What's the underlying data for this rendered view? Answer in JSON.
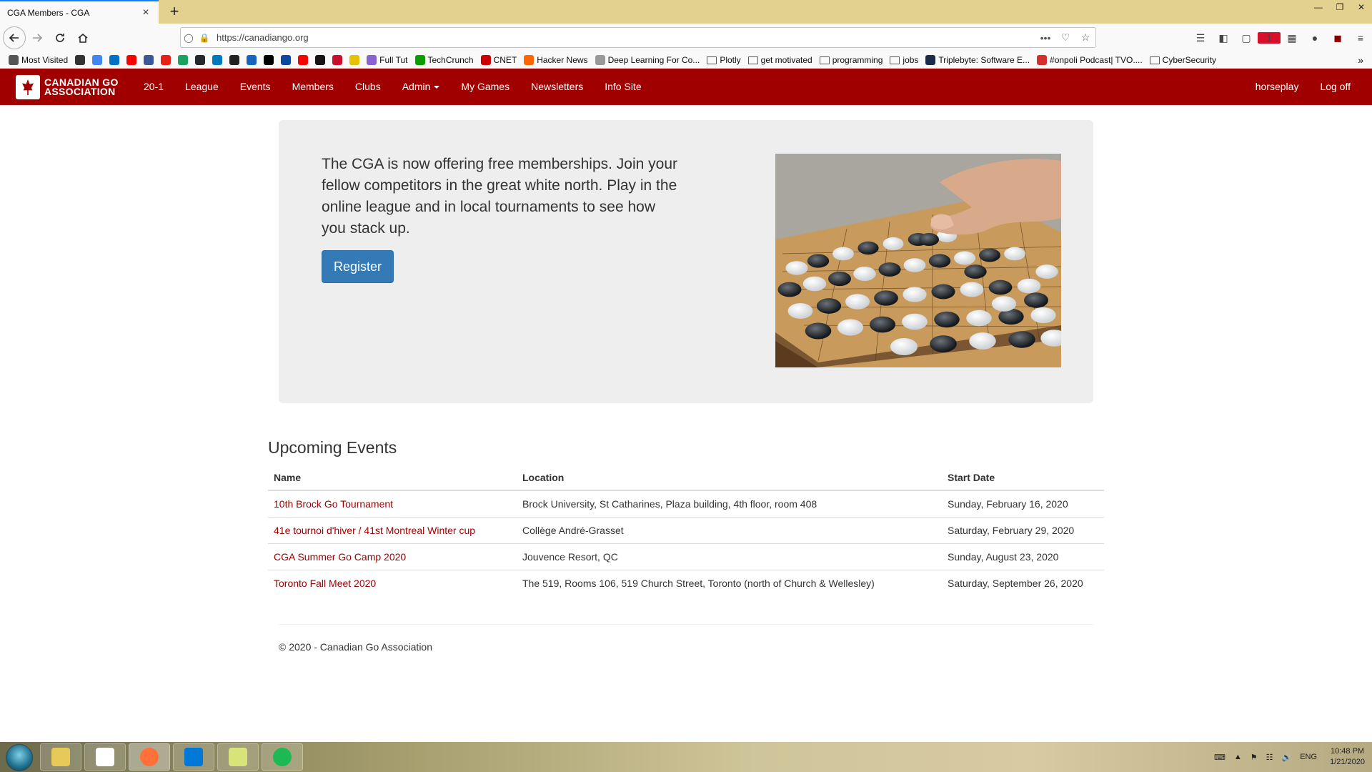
{
  "browser": {
    "tab_title": "CGA Members - CGA",
    "tab_close": "×",
    "new_tab": "+",
    "url": "https://canadiango.org",
    "url_dots": "•••",
    "bookmarks": [
      {
        "label": "Most Visited",
        "color": "#555555",
        "icon": "gear"
      },
      {
        "label": "",
        "color": "#333333",
        "icon": "globe"
      },
      {
        "label": "",
        "color": "#4285f4",
        "icon": "google"
      },
      {
        "label": "",
        "color": "#0072c6",
        "icon": "outlook"
      },
      {
        "label": "",
        "color": "#ff0000",
        "icon": "youtube"
      },
      {
        "label": "",
        "color": "#3b5998",
        "icon": "facebook"
      },
      {
        "label": "",
        "color": "#e62117",
        "icon": "app"
      },
      {
        "label": "",
        "color": "#1aa260",
        "icon": "app"
      },
      {
        "label": "",
        "color": "#24292e",
        "icon": "github"
      },
      {
        "label": "",
        "color": "#0079bf",
        "icon": "trello"
      },
      {
        "label": "",
        "color": "#222222",
        "icon": "app"
      },
      {
        "label": "",
        "color": "#1565c0",
        "icon": "app"
      },
      {
        "label": "",
        "color": "#000000",
        "icon": "app"
      },
      {
        "label": "",
        "color": "#0d47a1",
        "icon": "app"
      },
      {
        "label": "",
        "color": "#ff0000",
        "icon": "youtube"
      },
      {
        "label": "",
        "color": "#191414",
        "icon": "spotify"
      },
      {
        "label": "",
        "color": "#c8102e",
        "icon": "app"
      },
      {
        "label": "",
        "color": "#e6c200",
        "icon": "app"
      },
      {
        "label": "Full Tut",
        "color": "#8a63d2",
        "icon": "app"
      },
      {
        "label": "TechCrunch",
        "color": "#0a9e01",
        "icon": "app"
      },
      {
        "label": "CNET",
        "color": "#cc0000",
        "icon": "app"
      },
      {
        "label": "Hacker News",
        "color": "#ff6600",
        "icon": "app"
      },
      {
        "label": "Deep Learning For Co...",
        "color": "#999999",
        "icon": "app"
      },
      {
        "label": "Plotly",
        "color": "",
        "icon": "folder"
      },
      {
        "label": "get motivated",
        "color": "",
        "icon": "folder"
      },
      {
        "label": "programming",
        "color": "",
        "icon": "folder"
      },
      {
        "label": "jobs",
        "color": "",
        "icon": "folder"
      },
      {
        "label": "Triplebyte: Software E...",
        "color": "#1b2b4a",
        "icon": "app"
      },
      {
        "label": "#onpoli Podcast| TVO....",
        "color": "#d32f2f",
        "icon": "app"
      },
      {
        "label": "CyberSecurity",
        "color": "",
        "icon": "folder"
      }
    ]
  },
  "site": {
    "logo_line1": "CANADIAN GO",
    "logo_line2": "ASSOCIATION",
    "nav": {
      "season": "20-1",
      "league": "League",
      "events": "Events",
      "members": "Members",
      "clubs": "Clubs",
      "admin": "Admin",
      "my_games": "My Games",
      "newsletters": "Newsletters",
      "info_site": "Info Site",
      "user": "horseplay",
      "logoff": "Log off"
    },
    "colors": {
      "brand_red": "#a00000",
      "button_blue": "#337ab7"
    }
  },
  "jumbotron": {
    "text": "The CGA is now offering free memberships. Join your fellow competitors in the great white north. Play in the online league and in local tournaments to see how you stack up.",
    "register": "Register"
  },
  "events": {
    "title": "Upcoming Events",
    "headers": {
      "name": "Name",
      "location": "Location",
      "start_date": "Start Date"
    },
    "rows": [
      {
        "name": "10th Brock Go Tournament",
        "location": "Brock University, St Catharines, Plaza building, 4th floor, room 408",
        "start_date": "Sunday, February 16, 2020"
      },
      {
        "name": "41e tournoi d'hiver / 41st Montreal Winter cup",
        "location": "Collège André-Grasset",
        "start_date": "Saturday, February 29, 2020"
      },
      {
        "name": "CGA Summer Go Camp 2020",
        "location": "Jouvence Resort, QC",
        "start_date": "Sunday, August 23, 2020"
      },
      {
        "name": "Toronto Fall Meet 2020",
        "location": "The 519, Rooms 106, 519 Church Street, Toronto (north of Church & Wellesley)",
        "start_date": "Saturday, September 26, 2020"
      }
    ]
  },
  "footer": {
    "text": "© 2020 - Canadian Go Association"
  },
  "taskbar": {
    "lang": "ENG",
    "time": "10:48 PM",
    "date": "1/21/2020",
    "apps": [
      {
        "name": "file-explorer-icon",
        "color": "#e7c95a"
      },
      {
        "name": "slack-icon",
        "color": "#ffffff"
      },
      {
        "name": "firefox-icon",
        "color": "#ff7139"
      },
      {
        "name": "vscode-icon",
        "color": "#0078d7"
      },
      {
        "name": "folder-app-icon",
        "color": "#d8e37a"
      },
      {
        "name": "spotify-icon",
        "color": "#1db954"
      }
    ]
  }
}
